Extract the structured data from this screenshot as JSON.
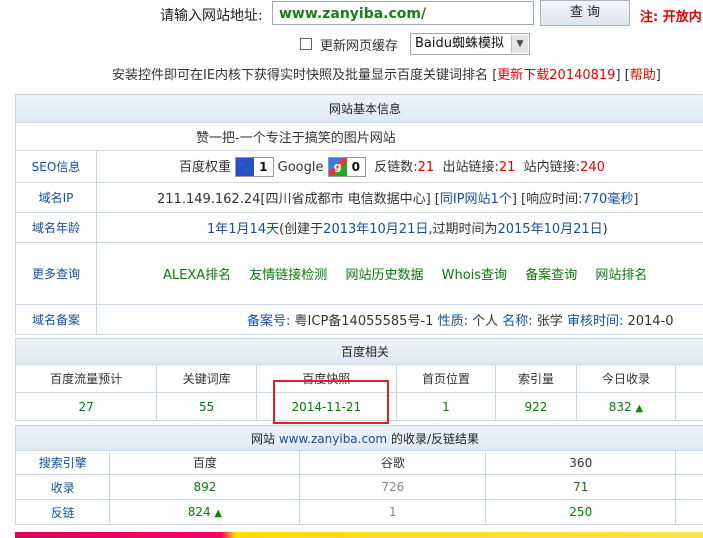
{
  "top": {
    "url_label": "请输入网站地址:",
    "url_value": "www.zanyiba.com/",
    "query_button": "查 询",
    "note": "注: 开放内",
    "refresh_cache": "更新网页缓存",
    "spider_select": "Baidu蜘蛛模拟",
    "install_text": "安装控件即可在IE内核下获得实时快照及批量显示百度关键词排名",
    "bracket_open": "[",
    "download_link": "更新下载20140819",
    "bracket_mid": "] [",
    "help_link": "帮助",
    "bracket_close": "]"
  },
  "basic": {
    "header": "网站基本信息",
    "site_title": "赞一把-一个专注于搞笑的图片网站",
    "seo": {
      "label": "SEO信息",
      "baidu_weight_label": "百度权重",
      "baidu_weight": "1",
      "google_label": "Google",
      "google_pr": "0",
      "backlinks_label": "反链数:",
      "backlinks": "21",
      "outbound_label": "出站链接:",
      "outbound": "21",
      "internal_label": "站内链接:",
      "internal": "240"
    },
    "ip": {
      "label": "域名IP",
      "value": "211.149.162.24[四川省成都市 电信数据中心]",
      "same_ip_open": "[",
      "same_ip": "同IP网站1个",
      "same_ip_close": "]",
      "resp_open": "[响应时间:",
      "resp_time": "770毫秒",
      "resp_close": "]"
    },
    "age": {
      "label": "域名年龄",
      "age": "1年1月14天",
      "created_prefix": "(创建于",
      "created": "2013年10月21日",
      "expire_prefix": ",过期时间为",
      "expire": "2015年10月21日",
      "suffix": ")"
    },
    "more": {
      "label": "更多查询",
      "links": [
        "ALEXA排名",
        "友情链接检测",
        "网站历史数据",
        "Whois查询",
        "备案查询",
        "网站排名"
      ]
    },
    "icp": {
      "label": "域名备案",
      "record_label": "备案号:",
      "record_value": "粤ICP备14055585号-1",
      "nature_label": "性质:",
      "nature_value": "个人",
      "name_label": "名称:",
      "name_value": "张学",
      "audit_label": "审核时间:",
      "audit_value": "2014-0"
    }
  },
  "baidu": {
    "header": "百度相关",
    "columns": [
      "百度流量预计",
      "关键词库",
      "百度快照",
      "首页位置",
      "索引量",
      "今日收录"
    ],
    "values": [
      "27",
      "55",
      "2014-11-21",
      "1",
      "922",
      "832"
    ]
  },
  "inclusion": {
    "header_prefix": "网站",
    "header_domain": "www.zanyiba.com",
    "header_suffix": "的收录/反链结果",
    "columns": [
      "搜索引擎",
      "百度",
      "谷歌",
      "360"
    ],
    "rows": [
      {
        "label": "收录",
        "values": [
          "892",
          "726",
          "71"
        ]
      },
      {
        "label": "反链",
        "values": [
          "824",
          "1",
          "250"
        ]
      }
    ]
  },
  "colors": {
    "red": "#e00000",
    "green": "#0a7a0a",
    "blue": "#14509b",
    "highlight": "#e02020"
  },
  "icons": [
    "paw-icon",
    "google-icon",
    "up-arrow-icon",
    "chevron-down-icon"
  ]
}
